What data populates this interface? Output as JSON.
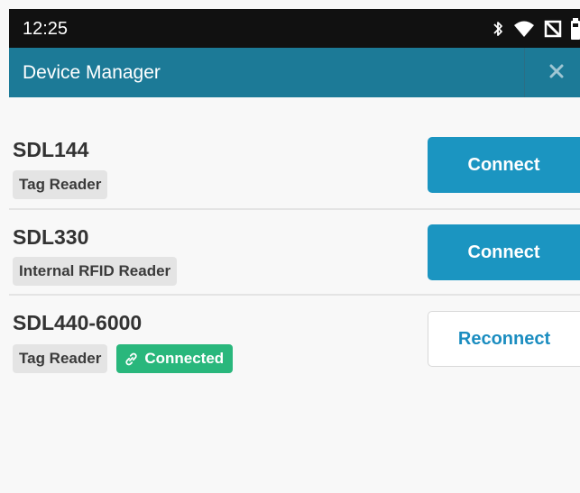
{
  "status_bar": {
    "time": "12:25",
    "icons": [
      "bluetooth-icon",
      "wifi-icon",
      "no-signal-icon",
      "battery-icon"
    ]
  },
  "app_bar": {
    "title": "Device Manager",
    "close_icon": "close-icon"
  },
  "devices": [
    {
      "name": "SDL144",
      "badges": [
        "Tag Reader"
      ],
      "action_label": "Connect",
      "connected": false
    },
    {
      "name": "SDL330",
      "badges": [
        "Internal RFID Reader"
      ],
      "action_label": "Connect",
      "connected": false
    },
    {
      "name": "SDL440-6000",
      "badges": [
        "Tag Reader"
      ],
      "connected_label": "Connected",
      "action_label": "Reconnect",
      "connected": true
    }
  ],
  "colors": {
    "status_bar": "#111111",
    "app_bar": "#1c7a97",
    "primary_button": "#1b95c1",
    "connected_badge": "#29b77c",
    "badge_background": "#e4e4e4",
    "background": "#f8f8f8"
  }
}
